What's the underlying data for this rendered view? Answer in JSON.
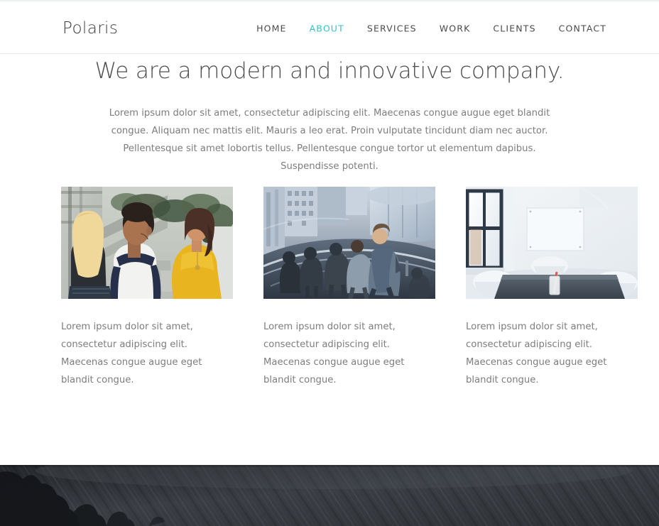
{
  "header": {
    "logo": "Polaris",
    "nav": [
      {
        "label": "HOME",
        "active": false
      },
      {
        "label": "ABOUT",
        "active": true
      },
      {
        "label": "SERVICES",
        "active": false
      },
      {
        "label": "WORK",
        "active": false
      },
      {
        "label": "CLIENTS",
        "active": false
      },
      {
        "label": "CONTACT",
        "active": false
      }
    ],
    "active_color": "#2cc6c8"
  },
  "intro": {
    "heading": "We are a modern and innovative company.",
    "paragraph": "Lorem ipsum dolor sit amet, consectetur adipiscing elit. Maecenas congue augue eget blandit congue. Aliquam nec mattis elit. Mauris a leo erat. Proin vulputate tincidunt diam nec auctor. Pellentesque sit amet lobortis tellus. Pellentesque congue tortor ut elementum dapibus. Suspendisse potenti."
  },
  "cards": [
    {
      "image_name": "three-young-people-talking-outdoors",
      "caption": "Lorem ipsum dolor sit amet, consectetur adipiscing elit. Maecenas congue augue eget blandit congue."
    },
    {
      "image_name": "commuters-on-curved-glass-staircase",
      "caption": "Lorem ipsum dolor sit amet, consectetur adipiscing elit. Maecenas congue augue eget blandit congue."
    },
    {
      "image_name": "bright-meeting-room-with-whiteboard",
      "caption": "Lorem ipsum dolor sit amet, consectetur adipiscing elit. Maecenas congue augue eget blandit congue."
    }
  ],
  "footer": {
    "image_name": "dark-textured-banner-with-tree-silhouette",
    "background_color": "#34373b"
  }
}
